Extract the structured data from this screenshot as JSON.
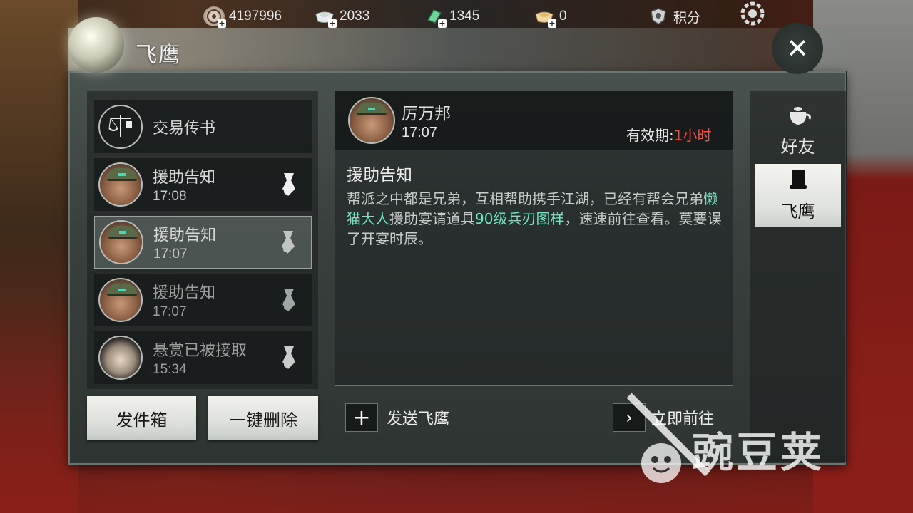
{
  "currencies": [
    {
      "icon": "coin-icon",
      "value": "4197996"
    },
    {
      "icon": "silver-ingot-icon",
      "value": "2033"
    },
    {
      "icon": "jade-icon",
      "value": "1345"
    },
    {
      "icon": "gold-ingot-icon",
      "value": "0"
    }
  ],
  "points": {
    "label": "积分"
  },
  "panel": {
    "title": "飞鹰"
  },
  "mail_list": [
    {
      "title": "交易传书",
      "time": "",
      "avatar": "scale-icon",
      "state": "normal"
    },
    {
      "title": "援助告知",
      "time": "17:08",
      "avatar": "official",
      "state": "unread"
    },
    {
      "title": "援助告知",
      "time": "17:07",
      "avatar": "official",
      "state": "selected"
    },
    {
      "title": "援助告知",
      "time": "17:07",
      "avatar": "official",
      "state": "read"
    },
    {
      "title": "悬赏已被接取",
      "time": "15:34",
      "avatar": "woman",
      "state": "read"
    }
  ],
  "buttons": {
    "outbox": "发件箱",
    "delete_all": "一键删除",
    "send": "发送飞鹰",
    "go_now": "立即前往"
  },
  "message": {
    "sender": "厉万邦",
    "time": "17:07",
    "validity_label": "有效期:",
    "validity_value": "1小时",
    "title": "援助告知",
    "body_part1": "帮派之中都是兄弟，互相帮助携手江湖，已经有帮会兄弟",
    "body_name": "懒猫大人",
    "body_part2": "援助宴请道具",
    "body_item": "90级兵刃图样",
    "body_part3": "，速速前往查看。莫要误了开宴时辰。"
  },
  "tabs": [
    {
      "label": "好友",
      "icon": "teapot-icon",
      "active": false
    },
    {
      "label": "飞鹰",
      "icon": "scroll-icon",
      "active": true
    }
  ],
  "watermark": {
    "text": "豌豆荚"
  },
  "colors": {
    "highlight": "#6fe3c2",
    "validity": "#ff4a3a"
  }
}
